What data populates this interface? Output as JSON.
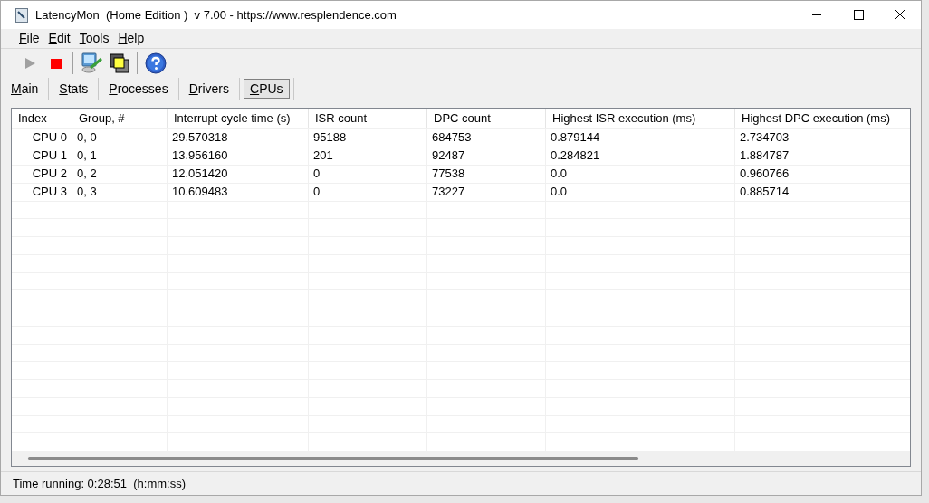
{
  "window": {
    "title": "LatencyMon  (Home Edition )  v 7.00 - https://www.resplendence.com"
  },
  "menu": [
    "File",
    "Edit",
    "Tools",
    "Help"
  ],
  "toolbar": [
    {
      "kind": "play",
      "disabled": true
    },
    {
      "kind": "stop",
      "disabled": false
    },
    {
      "kind": "separator"
    },
    {
      "kind": "monitor"
    },
    {
      "kind": "windows"
    },
    {
      "kind": "separator"
    },
    {
      "kind": "help"
    }
  ],
  "tabs": [
    {
      "label": "Main",
      "selected": false
    },
    {
      "label": "Stats",
      "selected": false
    },
    {
      "label": "Processes",
      "selected": false
    },
    {
      "label": "Drivers",
      "selected": false
    },
    {
      "label": "CPUs",
      "selected": true
    }
  ],
  "table": {
    "columns": [
      "Index",
      "Group, #",
      "Interrupt cycle time (s)",
      "ISR count",
      "DPC count",
      "Highest ISR execution (ms)",
      "Highest DPC execution (ms)"
    ],
    "rows": [
      [
        "CPU 0",
        "0, 0",
        "29.570318",
        "95188",
        "684753",
        "0.879144",
        "2.734703"
      ],
      [
        "CPU 1",
        "0, 1",
        "13.956160",
        "201",
        "92487",
        "0.284821",
        "1.884787"
      ],
      [
        "CPU 2",
        "0, 2",
        "12.051420",
        "0",
        "77538",
        "0.0",
        "0.960766"
      ],
      [
        "CPU 3",
        "0, 3",
        "10.609483",
        "0",
        "73227",
        "0.0",
        "0.885714"
      ]
    ]
  },
  "status_bar": "Time running: 0:28:51  (h:mm:ss)"
}
